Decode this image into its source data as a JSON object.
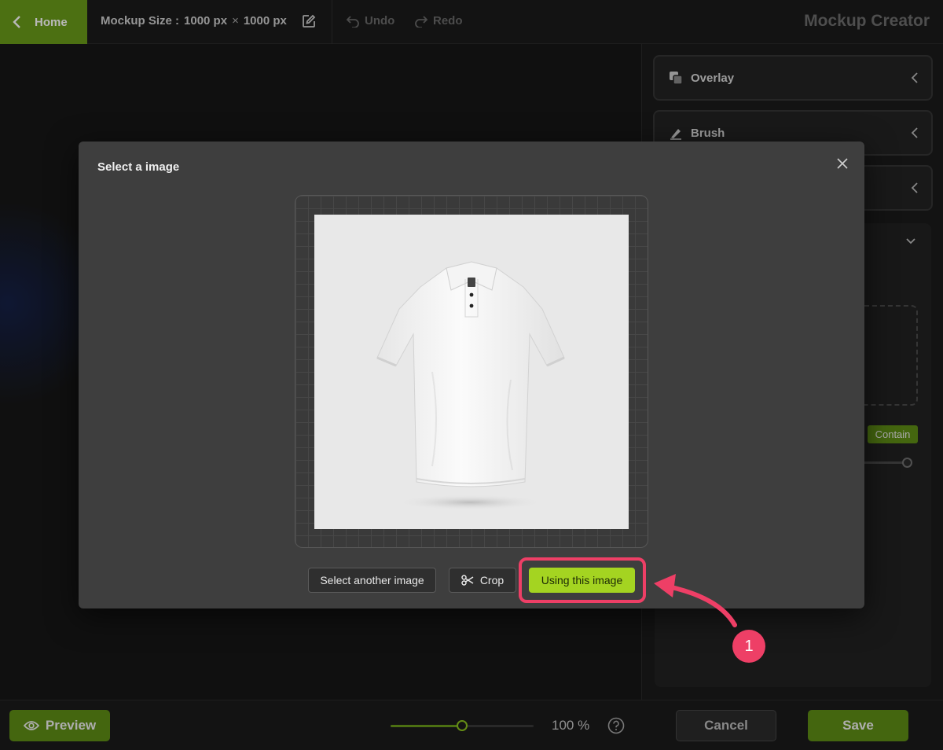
{
  "topbar": {
    "home_label": "Home",
    "size_label": "Mockup Size :",
    "width": "1000 px",
    "times": "×",
    "height": "1000 px",
    "undo_label": "Undo",
    "redo_label": "Redo",
    "app_title": "Mockup Creator"
  },
  "right_panel": {
    "sections": [
      {
        "label": "Overlay",
        "icon": "layers-icon"
      },
      {
        "label": "Brush",
        "icon": "brush-icon"
      },
      {
        "label": "",
        "icon": ""
      }
    ],
    "fit_mode": "Contain"
  },
  "modal": {
    "title": "Select a image",
    "buttons": {
      "another": "Select another image",
      "crop": "Crop",
      "use": "Using this image"
    }
  },
  "annotation": {
    "step_number": "1",
    "color": "#ee3f66"
  },
  "bottombar": {
    "preview_label": "Preview",
    "zoom_level": 0.5,
    "zoom_text": "100 %",
    "cancel_label": "Cancel",
    "save_label": "Save"
  },
  "colors": {
    "accent": "#6a9b1a",
    "accent_bright": "#a4d421",
    "background": "#151515"
  }
}
